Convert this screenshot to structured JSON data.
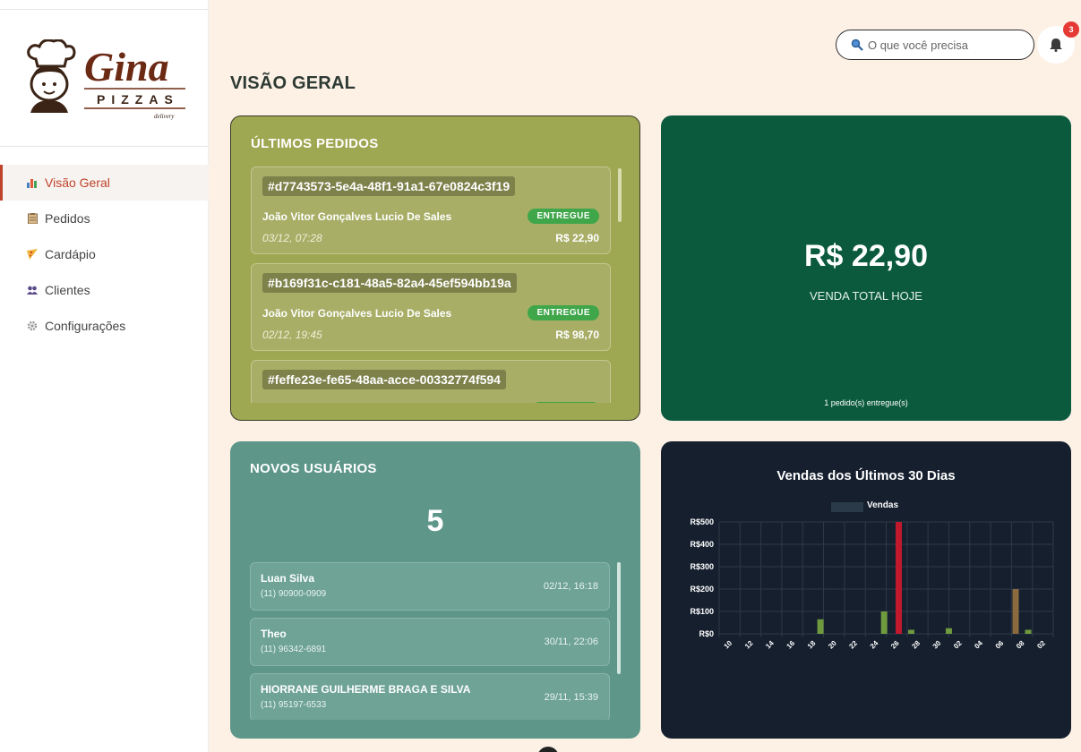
{
  "brand": {
    "name": "Gina",
    "sub": "PIZZAS",
    "tag": "delivery"
  },
  "sidebar": {
    "items": [
      {
        "label": "Visão Geral",
        "icon": "chart-icon",
        "active": true
      },
      {
        "label": "Pedidos",
        "icon": "clipboard-icon"
      },
      {
        "label": "Cardápio",
        "icon": "pizza-slice-icon"
      },
      {
        "label": "Clientes",
        "icon": "users-icon"
      },
      {
        "label": "Configurações",
        "icon": "gear-icon"
      }
    ]
  },
  "header": {
    "title": "VISÃO GERAL",
    "search_placeholder": "O que você precisa",
    "notifications": "3"
  },
  "orders": {
    "title": "ÚLTIMOS PEDIDOS",
    "items": [
      {
        "id": "#d7743573-5e4a-48f1-91a1-67e0824c3f19",
        "name": "João Vitor Gonçalves Lucio De Sales",
        "status": "ENTREGUE",
        "date": "03/12, 07:28",
        "total": "R$ 22,90"
      },
      {
        "id": "#b169f31c-c181-48a5-82a4-45ef594bb19a",
        "name": "João Vitor Gonçalves Lucio De Sales",
        "status": "ENTREGUE",
        "date": "02/12, 19:45",
        "total": "R$ 98,70"
      },
      {
        "id": "#feffe23e-fe65-48aa-acce-00332774f594",
        "name": "",
        "status": "",
        "date": "",
        "total": ""
      }
    ]
  },
  "sales": {
    "value": "R$ 22,90",
    "label": "VENDA TOTAL HOJE",
    "footer": "1 pedido(s) entregue(s)"
  },
  "users": {
    "title": "NOVOS USUÁRIOS",
    "count": "5",
    "items": [
      {
        "name": "Luan Silva",
        "phone": "(11) 90900-0909",
        "date": "02/12, 16:18"
      },
      {
        "name": "Theo",
        "phone": "(11) 96342-6891",
        "date": "30/11, 22:06"
      },
      {
        "name": "HIORRANE GUILHERME BRAGA E SILVA",
        "phone": "(11) 95197-6533",
        "date": "29/11, 15:39"
      }
    ]
  },
  "chart_data": {
    "type": "bar",
    "title": "Vendas dos Últimos 30 Dias",
    "series": [
      {
        "name": "Vendas"
      }
    ],
    "yticks": [
      "R$0",
      "R$100",
      "R$200",
      "R$300",
      "R$400",
      "R$500"
    ],
    "ylim": [
      0,
      500
    ],
    "xticks": [
      "10",
      "12",
      "14",
      "16",
      "18",
      "20",
      "22",
      "24",
      "26",
      "28",
      "30",
      "02",
      "04",
      "06",
      "08",
      "02"
    ],
    "bars": [
      {
        "pos": 4.85,
        "value": 65,
        "color": "#6f9a3e"
      },
      {
        "pos": 7.9,
        "value": 100,
        "color": "#6f9a3e"
      },
      {
        "pos": 8.6,
        "value": 500,
        "color": "#c0192c"
      },
      {
        "pos": 9.2,
        "value": 18,
        "color": "#6f9a3e"
      },
      {
        "pos": 11.0,
        "value": 25,
        "color": "#6f9a3e"
      },
      {
        "pos": 14.2,
        "value": 200,
        "color": "#8a6a3e"
      },
      {
        "pos": 14.8,
        "value": 18,
        "color": "#6f9a3e"
      }
    ],
    "grid": true,
    "legend": "top"
  }
}
